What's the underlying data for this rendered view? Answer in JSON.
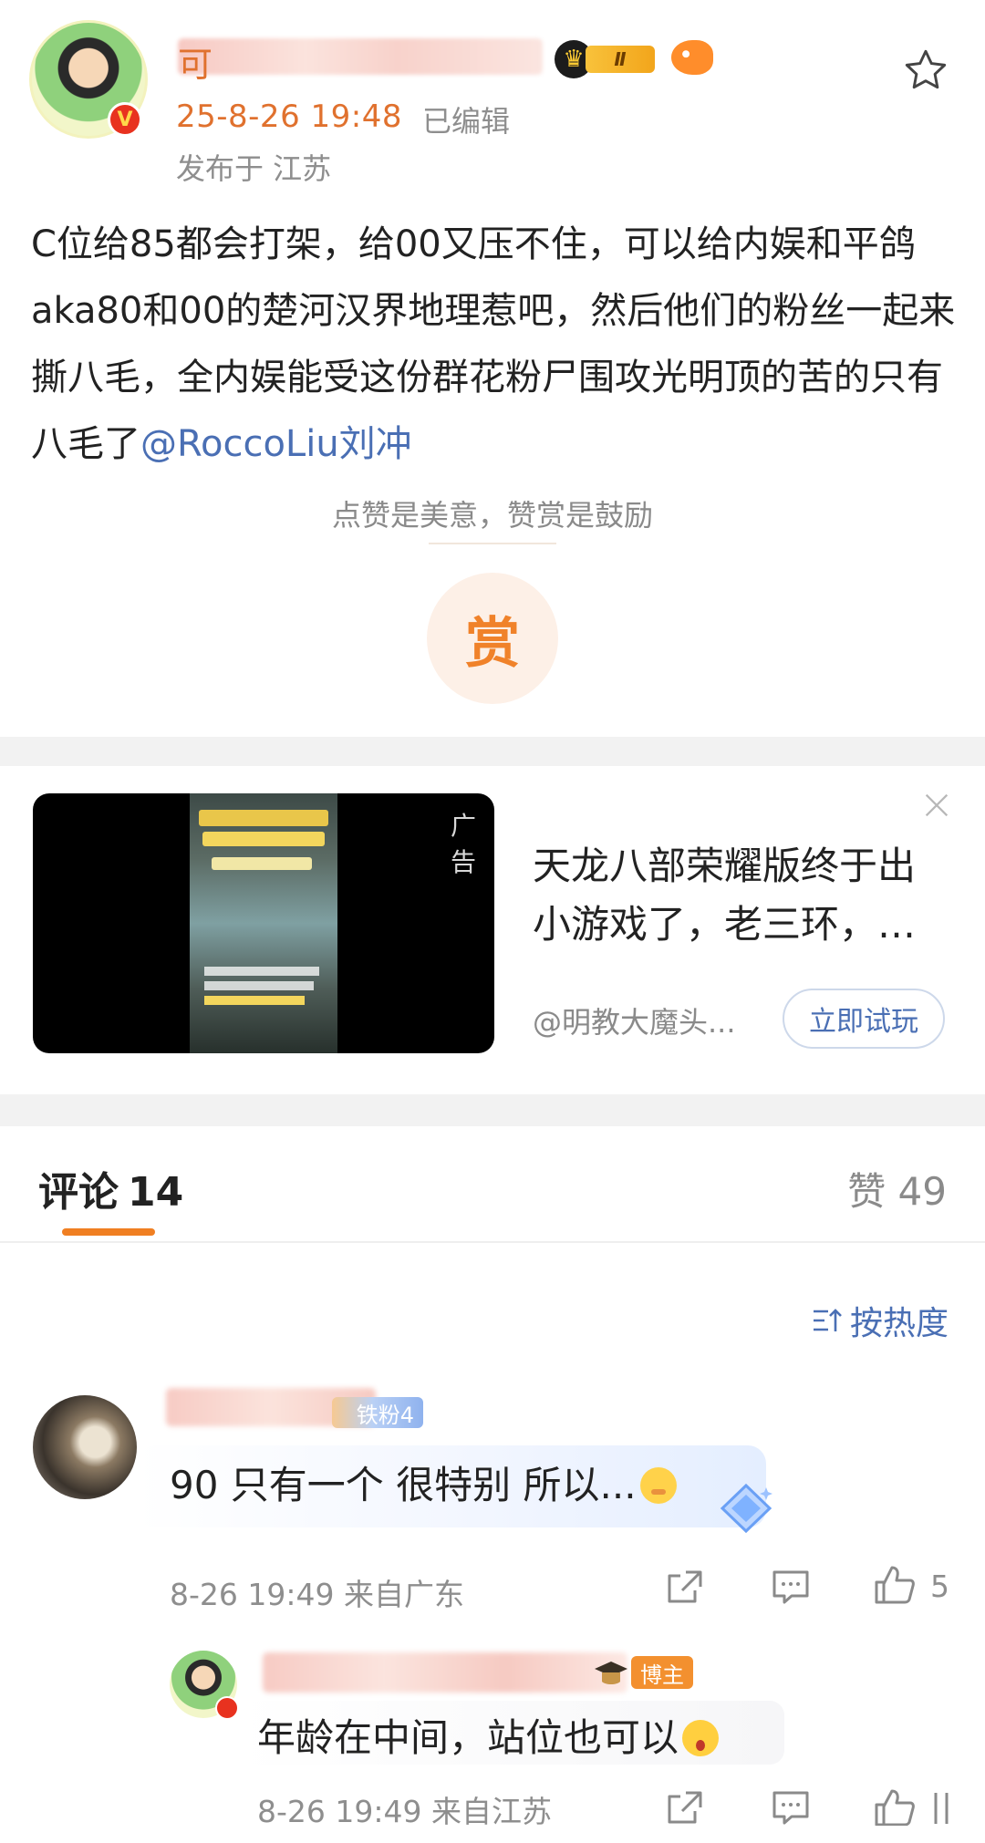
{
  "post": {
    "author_first_char": "可",
    "level_badge": "Ⅱ",
    "verified_mark": "V",
    "time": "25-8-26 19:48",
    "edited": "已编辑",
    "location": "发布于 江苏",
    "text_main": "C位给85都会打架，给00又压不住，可以给内娱和平鸽aka80和00的楚河汉界地理惹吧，然后他们的粉丝一起来撕八毛，全内娱能受这份群花粉尸围攻光明顶的苦的只有八毛了",
    "mention": "@RoccoLiu刘冲"
  },
  "reward": {
    "hint": "点赞是美意，赞赏是鼓励",
    "button_label": "赏"
  },
  "ad": {
    "label": "广告",
    "title": "天龙八部荣耀版终于出小游戏了，老三环，…",
    "source": "@明教大魔头...",
    "cta": "立即试玩"
  },
  "tabs": {
    "comments_label": "评论",
    "comments_count": "14",
    "likes_label": "赞 49"
  },
  "sort": {
    "label": "按热度"
  },
  "comments": [
    {
      "fan_badge": "铁粉4",
      "text": "90 只有一个 很特别 所以...",
      "meta": "8-26 19:49  来自广东",
      "likes": "5"
    }
  ],
  "reply": {
    "badge": "博主",
    "text": "年龄在中间，站位也可以",
    "meta": "8-26 19:49  来自江苏"
  },
  "colors": {
    "accent": "#f07f22",
    "link": "#4a6fb4",
    "muted": "#8e8e8e"
  },
  "icons": {
    "favorite": "star-icon",
    "close": "close-icon",
    "sort": "sort-icon",
    "share": "share-icon",
    "reply": "comment-icon",
    "like": "thumbs-up-icon"
  }
}
